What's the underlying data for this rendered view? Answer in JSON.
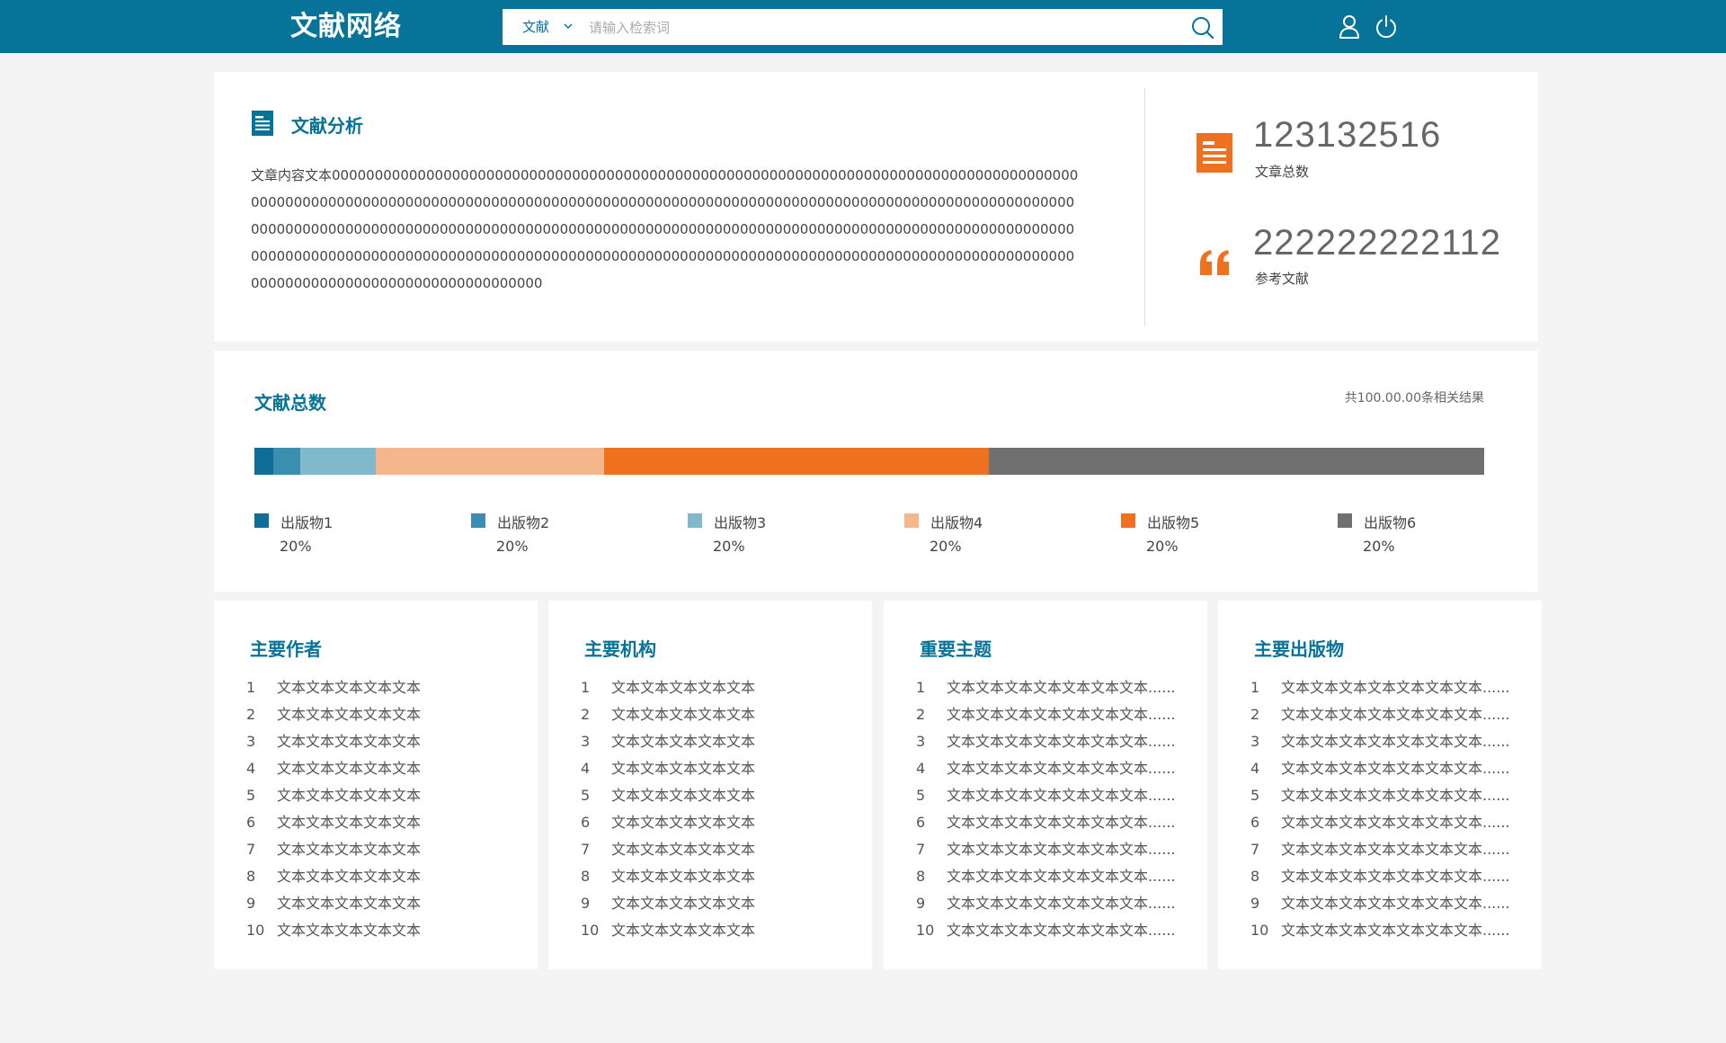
{
  "header": {
    "logo": "文献网络",
    "search": {
      "scope": "文献",
      "placeholder": "请输入检索词",
      "value": ""
    },
    "icons": [
      "user-icon",
      "power-icon",
      "search-icon",
      "chevron-down-icon"
    ]
  },
  "analysis": {
    "title": "文献分析",
    "text": "文章内容文本0000000000000000000000000000000000000000000000000000000000000000000000000000000000000000000000000000000000000000000000000000000000000000000000000000000000000000000000000000000000000000000000000000000000000000000000000000000000000000000000000000000000000000000000000000000000000000000000000000000000000000000000000000000000000000000000000000000000000000000000000000000000000000000000000000000000000000000000000",
    "stats": [
      {
        "value": "123132516",
        "label": "文章总数",
        "icon": "article-icon"
      },
      {
        "value": "222222222112",
        "label": "参考文献",
        "icon": "quote-icon"
      }
    ]
  },
  "total": {
    "title": "文献总数",
    "summary": "共100.00.00条相关结果",
    "chart_data": {
      "type": "bar",
      "categories": [
        "出版物1",
        "出版物2",
        "出版物3",
        "出版物4",
        "出版物5",
        "出版物6"
      ],
      "values": [
        1.5,
        2.2,
        6.2,
        18.5,
        31.3,
        40.3
      ],
      "labels": [
        "20%",
        "20%",
        "20%",
        "20%",
        "20%",
        "20%"
      ],
      "colors": [
        "#0e6e96",
        "#3a8fae",
        "#80b9cc",
        "#f6b68d",
        "#ee7120",
        "#707070"
      ],
      "stacked": true,
      "orientation": "horizontal"
    }
  },
  "lists": [
    {
      "title": "主要作者",
      "items": [
        "文本文本文本文本文本",
        "文本文本文本文本文本",
        "文本文本文本文本文本",
        "文本文本文本文本文本",
        "文本文本文本文本文本",
        "文本文本文本文本文本",
        "文本文本文本文本文本",
        "文本文本文本文本文本",
        "文本文本文本文本文本",
        "文本文本文本文本文本"
      ]
    },
    {
      "title": "主要机构",
      "items": [
        "文本文本文本文本文本",
        "文本文本文本文本文本",
        "文本文本文本文本文本",
        "文本文本文本文本文本",
        "文本文本文本文本文本",
        "文本文本文本文本文本",
        "文本文本文本文本文本",
        "文本文本文本文本文本",
        "文本文本文本文本文本",
        "文本文本文本文本文本"
      ]
    },
    {
      "title": "重要主题",
      "items": [
        "文本文本文本文本文本文本文本......",
        "文本文本文本文本文本文本文本......",
        "文本文本文本文本文本文本文本......",
        "文本文本文本文本文本文本文本......",
        "文本文本文本文本文本文本文本......",
        "文本文本文本文本文本文本文本......",
        "文本文本文本文本文本文本文本......",
        "文本文本文本文本文本文本文本......",
        "文本文本文本文本文本文本文本......",
        "文本文本文本文本文本文本文本......"
      ]
    },
    {
      "title": "主要出版物",
      "items": [
        "文本文本文本文本文本文本文本......",
        "文本文本文本文本文本文本文本......",
        "文本文本文本文本文本文本文本......",
        "文本文本文本文本文本文本文本......",
        "文本文本文本文本文本文本文本......",
        "文本文本文本文本文本文本文本......",
        "文本文本文本文本文本文本文本......",
        "文本文本文本文本文本文本文本......",
        "文本文本文本文本文本文本文本......",
        "文本文本文本文本文本文本文本......"
      ]
    }
  ]
}
